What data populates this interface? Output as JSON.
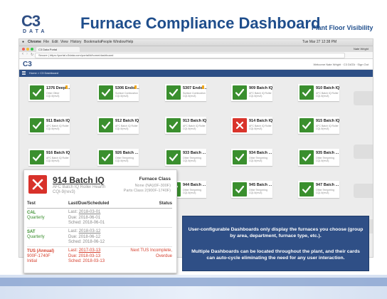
{
  "header": {
    "logo_big": "C3",
    "logo_small": "DATA",
    "title": "Furnace Compliance Dashboard",
    "subtitle": "Plant Floor Visibility"
  },
  "browser": {
    "menu": [
      "Chrome",
      "File",
      "Edit",
      "View",
      "History",
      "Bookmarks",
      "People",
      "Window",
      "Help"
    ],
    "clock": "Tue Mar 27  12:38 PM",
    "user": "Nate Wright",
    "tab_title": "C3 Data Portal",
    "url": "Secure  |  https://portal.c3data.com/portal/#/home/dashboard",
    "app_logo": "C3",
    "welcome": "Welcome Nate Wright  ·  C3 DATA  ·  Sign Out",
    "breadcrumb": "Home  >  C3 Dashboard"
  },
  "cards": [
    {
      "name": "1376 Deep ...",
      "l1": "Other Other",
      "l2": "CQI-9(rev3)",
      "status": "ok",
      "flag": true
    },
    {
      "name": "5306 Endo ...",
      "l1": "Surface Combustion",
      "l2": "CQI-9(rev3)",
      "status": "ok",
      "flag": true
    },
    {
      "name": "5307 Endo ...",
      "l1": "Surface Combustion",
      "l2": "CQI-9(rev3)",
      "status": "ok",
      "flag": true
    },
    {
      "name": "909 Batch IQ",
      "l1": "AFC Batch IQ Roller",
      "l2": "CQI-9(rev3)",
      "status": "ok",
      "flag": false
    },
    {
      "name": "910 Batch IQ",
      "l1": "AFC Batch IQ Roller",
      "l2": "CQI-9(rev3)",
      "status": "ok",
      "flag": false
    },
    {
      "name": "911 Batch IQ",
      "l1": "AFC Batch IQ Roller",
      "l2": "CQI-9(rev3)",
      "status": "ok",
      "flag": false
    },
    {
      "name": "912 Batch IQ",
      "l1": "AFC Batch IQ Roller",
      "l2": "CQI-9(rev3)",
      "status": "ok",
      "flag": false
    },
    {
      "name": "913 Batch IQ",
      "l1": "AFC Batch IQ Roller",
      "l2": "CQI-9(rev3)",
      "status": "ok",
      "flag": false
    },
    {
      "name": "914 Batch IQ",
      "l1": "AFC Batch IQ Roller",
      "l2": "CQI-9(rev3)",
      "status": "bad",
      "flag": false
    },
    {
      "name": "915 Batch IQ",
      "l1": "AFC Batch IQ Roller",
      "l2": "CQI-9(rev3)",
      "status": "ok",
      "flag": false
    },
    {
      "name": "916 Batch IQ",
      "l1": "AFC Batch IQ Roller",
      "l2": "CQI-9(rev3)",
      "status": "ok",
      "flag": false
    },
    {
      "name": "926 Batch ...",
      "l1": "Other Tempering",
      "l2": "CQI-9(rev3)",
      "status": "ok",
      "flag": false
    },
    {
      "name": "933 Batch ...",
      "l1": "Other Tempering",
      "l2": "CQI-9(rev3)",
      "status": "ok",
      "flag": false
    },
    {
      "name": "934 Batch ...",
      "l1": "Other Tempering",
      "l2": "CQI-9(rev3)",
      "status": "ok",
      "flag": false
    },
    {
      "name": "935 Batch ...",
      "l1": "Other Tempering",
      "l2": "CQI-9(rev3)",
      "status": "ok",
      "flag": false
    },
    {
      "name": "944 Batch ...",
      "l1": "Other Tempering",
      "l2": "CQI-9(rev3)",
      "status": "ok",
      "flag": false
    },
    {
      "name": "945 Batch ...",
      "l1": "Other Tempering",
      "l2": "CQI-9(rev3)",
      "status": "ok",
      "flag": false
    },
    {
      "name": "947 Batch ...",
      "l1": "Other Tempering",
      "l2": "CQI-9(rev3)",
      "status": "ok",
      "flag": false
    }
  ],
  "detail": {
    "title": "914 Batch IQ",
    "line1": "AFC Batch IQ Roller Hearth",
    "line2": "CQI-9(rev3)",
    "class_label": "Furnace Class",
    "class_line1": "None (NA)(0F-300F)",
    "class_line2": "Parts Class 2(900F-1740F)",
    "col_test": "Test",
    "col_dates": "Last/Due/Scheduled",
    "col_status": "Status",
    "tests": [
      {
        "name": "CAL",
        "sub": "Quarterly",
        "last": "2018-03-01",
        "due": "2018-06-01",
        "sched": "2018-06-01",
        "status1": "",
        "status2": "",
        "color": "#3a8f2e"
      },
      {
        "name": "SAT",
        "sub": "Quarterly",
        "last": "2018-03-12",
        "due": "2018-06-12",
        "sched": "2018-06-12",
        "status1": "",
        "status2": "",
        "color": "#3a8f2e"
      },
      {
        "name": "TUS (Annual)",
        "sub": "900F-1740F",
        "sub2": "Initial",
        "last": "2017-03-13",
        "due": "2018-03-13",
        "sched": "2018-03-13",
        "status1": "Next TUS Incomplete,",
        "status2": "Overdue",
        "color": "#d5402e"
      }
    ],
    "lbl_last": "Last:",
    "lbl_due": "Due:",
    "lbl_sched": "Sched:"
  },
  "info": {
    "p1": "User-configurable Dashboards only display the furnaces you choose (group by area, department, furnace type, etc.).",
    "p2": "Multiple Dashboards can be located throughout the plant, and their cards can auto-cycle eliminating the need for any user interaction."
  },
  "colors": {
    "brand": "#2f4f84",
    "ok": "#3a8f2e",
    "bad": "#d9342b",
    "info_bg": "#2f4f86"
  }
}
